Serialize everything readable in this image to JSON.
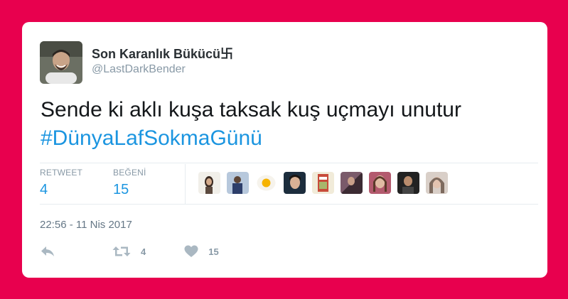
{
  "tweet": {
    "author": {
      "display_name": "Son Karanlık Bükücü卐",
      "handle": "@LastDarkBender"
    },
    "text": "Sende ki aklı kuşa taksak kuş uçmayı unutur",
    "hashtag": "#DünyaLafSokmaGünü",
    "stats": {
      "retweet_label": "RETWEET",
      "retweet_count": "4",
      "like_label": "BEĞENİ",
      "like_count": "15"
    },
    "timestamp": "22:56 - 11 Nis 2017",
    "actions": {
      "reply_icon": "reply-icon",
      "retweet_icon": "retweet-icon",
      "retweet_count": "4",
      "like_icon": "heart-icon",
      "like_count": "15"
    }
  },
  "colors": {
    "background": "#E8004E",
    "link": "#1b95e0",
    "muted": "#8899a6"
  }
}
